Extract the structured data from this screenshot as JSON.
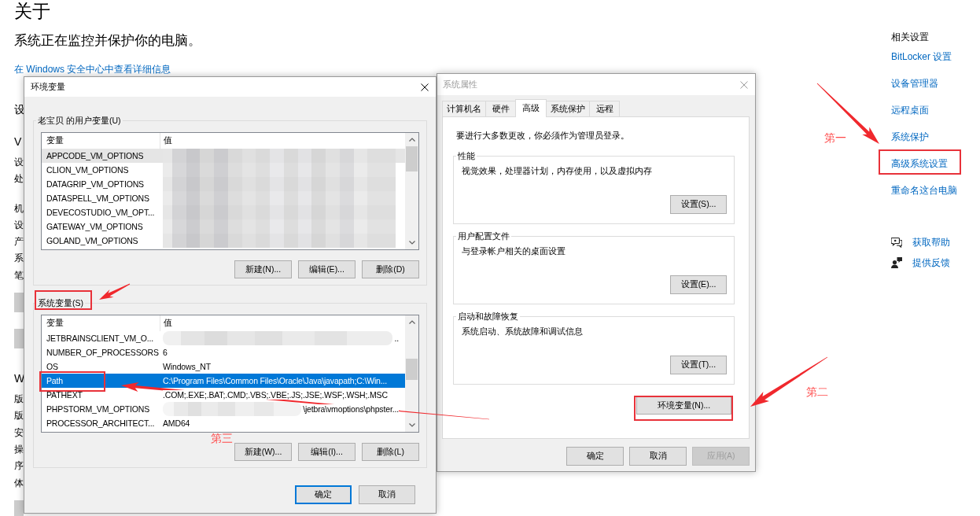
{
  "settings_page": {
    "title": "关于",
    "status_text": "系统正在监控并保护你的电脑。",
    "security_link": "在 Windows 安全中心中查看详细信息",
    "covered_content": [
      {
        "kind": "heading",
        "text": "设"
      },
      {
        "kind": "heading",
        "text": "V"
      },
      {
        "kind": "paragraph",
        "lines": [
          "设",
          "处"
        ]
      },
      {
        "kind": "paragraph",
        "lines": [
          "机",
          "设",
          "产",
          "系",
          "笔"
        ]
      },
      {
        "kind": "button"
      },
      {
        "kind": "button"
      },
      {
        "kind": "heading",
        "text": "W"
      },
      {
        "kind": "paragraph",
        "lines": [
          "版",
          "版",
          "安",
          "操",
          "序",
          "体"
        ]
      },
      {
        "kind": "button"
      }
    ],
    "related_settings": {
      "title": "相关设置",
      "links": [
        {
          "label": "BitLocker 设置",
          "highlighted": false
        },
        {
          "label": "设备管理器",
          "highlighted": false
        },
        {
          "label": "远程桌面",
          "highlighted": false
        },
        {
          "label": "系统保护",
          "highlighted": false
        },
        {
          "label": "高级系统设置",
          "highlighted": true
        },
        {
          "label": "重命名这台电脑",
          "highlighted": false
        }
      ]
    },
    "help_links": [
      {
        "kind": "help",
        "label": "获取帮助"
      },
      {
        "kind": "feedback",
        "label": "提供反馈"
      }
    ]
  },
  "system_properties": {
    "title": "系统属性",
    "active": false,
    "tabs": [
      {
        "label": "计算机名",
        "selected": false
      },
      {
        "label": "硬件",
        "selected": false
      },
      {
        "label": "高级",
        "selected": true
      },
      {
        "label": "系统保护",
        "selected": false
      },
      {
        "label": "远程",
        "selected": false
      }
    ],
    "notice": "要进行大多数更改，你必须作为管理员登录。",
    "groups": [
      {
        "label": "性能",
        "description": "视觉效果，处理器计划，内存使用，以及虚拟内存",
        "button": "设置(S)..."
      },
      {
        "label": "用户配置文件",
        "description": "与登录帐户相关的桌面设置",
        "button": "设置(E)..."
      },
      {
        "label": "启动和故障恢复",
        "description": "系统启动、系统故障和调试信息",
        "button": "设置(T)..."
      }
    ],
    "environment_button": {
      "label": "环境变量(N)...",
      "highlighted": true
    },
    "buttons": [
      {
        "label": "确定",
        "disabled": false
      },
      {
        "label": "取消",
        "disabled": false
      },
      {
        "label": "应用(A)",
        "disabled": true
      }
    ]
  },
  "environment_variables": {
    "title": "环境变量",
    "active": true,
    "user_variables": {
      "label": "老宝贝 的用户变量(U)",
      "highlighted": false,
      "focused": false,
      "columns": [
        "变量",
        "值"
      ],
      "rows": [
        {
          "name": "APPCODE_VM_OPTIONS",
          "redacted": true,
          "selected": true,
          "highlighted": false
        },
        {
          "name": "CLION_VM_OPTIONS",
          "redacted": true,
          "selected": false,
          "highlighted": false
        },
        {
          "name": "DATAGRIP_VM_OPTIONS",
          "redacted": true,
          "selected": false,
          "highlighted": false
        },
        {
          "name": "DATASPELL_VM_OPTIONS",
          "redacted": true,
          "selected": false,
          "highlighted": false
        },
        {
          "name": "DEVECOSTUDIO_VM_OPT...",
          "redacted": true,
          "selected": false,
          "highlighted": false
        },
        {
          "name": "GATEWAY_VM_OPTIONS",
          "redacted": true,
          "selected": false,
          "highlighted": false
        },
        {
          "name": "GOLAND_VM_OPTIONS",
          "redacted": true,
          "selected": false,
          "highlighted": false
        }
      ],
      "buttons": [
        "新建(N)...",
        "编辑(E)...",
        "删除(D)"
      ]
    },
    "system_variables": {
      "label": "系统变量(S)",
      "highlighted": true,
      "focused": true,
      "columns": [
        "变量",
        "值"
      ],
      "rows": [
        {
          "name": "JETBRAINSCLIENT_VM_O...",
          "value": "..",
          "redacted": true,
          "selected": false,
          "highlighted": false
        },
        {
          "name": "NUMBER_OF_PROCESSORS",
          "value": "6",
          "redacted": false,
          "selected": false,
          "highlighted": false
        },
        {
          "name": "OS",
          "value": "Windows_NT",
          "redacted": false,
          "selected": false,
          "highlighted": false
        },
        {
          "name": "Path",
          "value": "C:\\Program Files\\Common Files\\Oracle\\Java\\javapath;C:\\Win...",
          "redacted": false,
          "selected": true,
          "highlighted": true
        },
        {
          "name": "PATHEXT",
          "value": ".COM;.EXE;.BAT;.CMD;.VBS;.VBE;.JS;.JSE;.WSF;.WSH;.MSC",
          "redacted": false,
          "selected": false,
          "highlighted": false
        },
        {
          "name": "PHPSTORM_VM_OPTIONS",
          "value": "\\jetbra\\vmoptions\\phpster...",
          "redacted": true,
          "selected": false,
          "highlighted": false
        },
        {
          "name": "PROCESSOR_ARCHITECT...",
          "value": "AMD64",
          "redacted": false,
          "selected": false,
          "highlighted": false
        }
      ],
      "buttons": [
        "新建(W)...",
        "编辑(I)...",
        "删除(L)"
      ]
    },
    "buttons": [
      {
        "label": "确定",
        "default": true
      },
      {
        "label": "取消",
        "default": false
      }
    ]
  },
  "annotations": [
    {
      "label": "第一"
    },
    {
      "label": "第二"
    },
    {
      "label": "第三"
    }
  ]
}
